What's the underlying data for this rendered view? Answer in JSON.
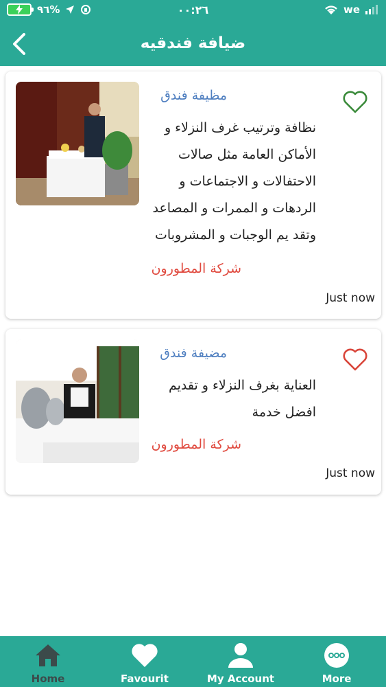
{
  "status_bar": {
    "battery": "٩٦%",
    "time": "٠٠:٢٦",
    "carrier": "we"
  },
  "header": {
    "title": "ضيافة فندقيه",
    "back_icon": "chevron-left-icon"
  },
  "jobs": [
    {
      "title": "مظيفة فندق",
      "description": "نظافة وترتيب غرف النزلاء و الأماكن العامة مثل صالات الاحتفالات و الاجتماعات و الردهات و الممرات و المصاعد وتقد يم الوجبات و المشروبات",
      "company": "شركة المطورون",
      "time": "Just now",
      "favourite_color": "#3a8a3a",
      "favourite_icon": "heart-outline-icon"
    },
    {
      "title": "مضيفة فندق",
      "description": "العناية بغرف النزلاء و تقديم افضل خدمة",
      "company": "شركة المطورون",
      "time": "Just now",
      "favourite_color": "#d9453a",
      "favourite_icon": "heart-outline-icon"
    }
  ],
  "bottom_nav": {
    "items": [
      {
        "label": "Home",
        "icon": "home-icon"
      },
      {
        "label": "Favourit",
        "icon": "heart-icon"
      },
      {
        "label": "My Account",
        "icon": "user-icon"
      },
      {
        "label": "More",
        "icon": "more-icon"
      }
    ],
    "active": "Home"
  },
  "colors": {
    "primary": "#2aa996",
    "title_blue": "#4f7fc0",
    "company_red": "#e04a3f",
    "inactive_nav": "#3c4a4a"
  }
}
